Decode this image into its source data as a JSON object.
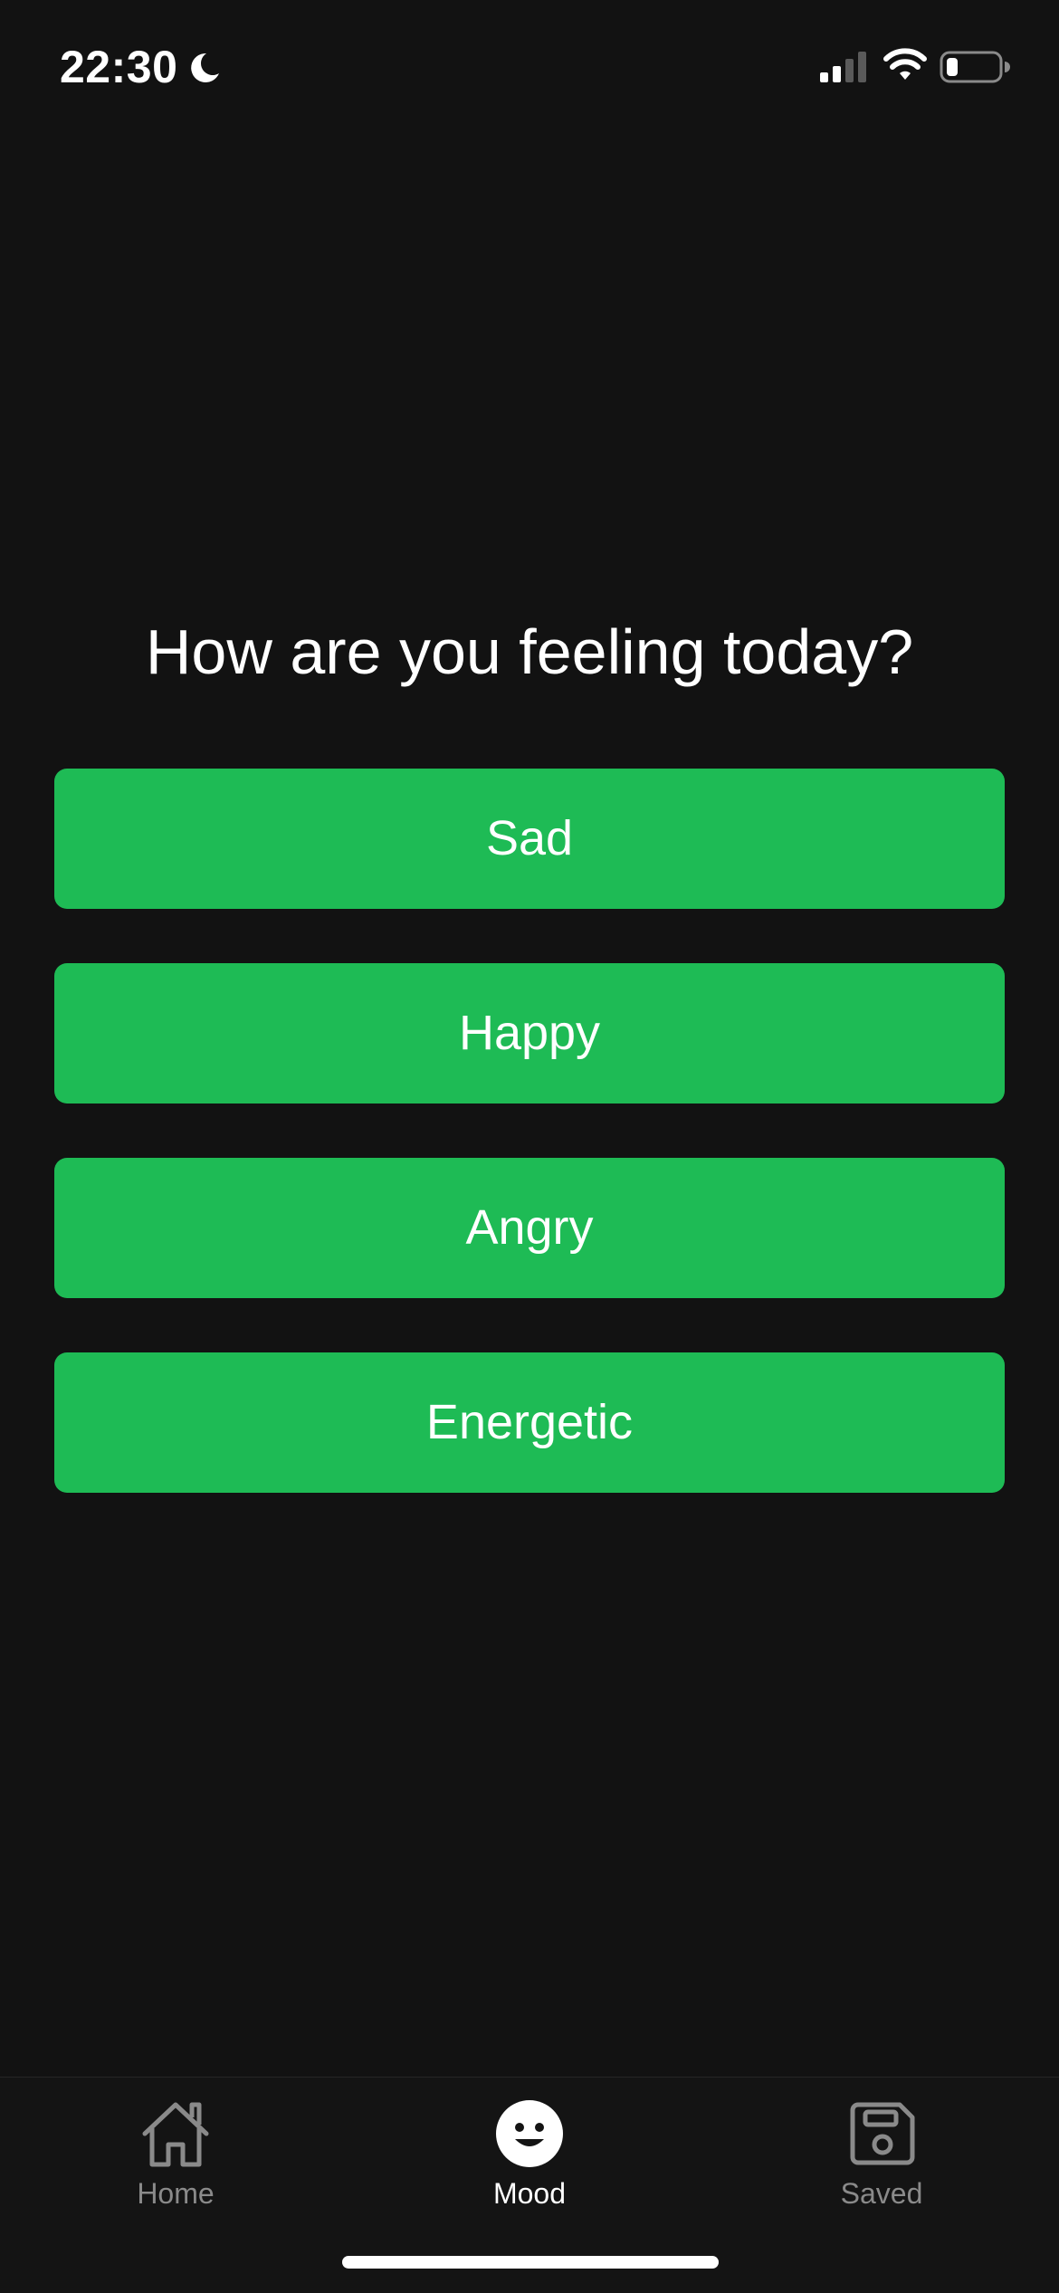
{
  "status_bar": {
    "time": "22:30",
    "icons": [
      "moon-icon",
      "cellular-signal-icon",
      "wifi-icon",
      "battery-icon"
    ]
  },
  "main": {
    "question": "How are you feeling today?",
    "moods": [
      {
        "label": "Sad"
      },
      {
        "label": "Happy"
      },
      {
        "label": "Angry"
      },
      {
        "label": "Energetic"
      }
    ]
  },
  "tab_bar": {
    "active": "Mood",
    "tabs": [
      {
        "label": "Home",
        "icon": "house-icon"
      },
      {
        "label": "Mood",
        "icon": "smiley-face-icon"
      },
      {
        "label": "Saved",
        "icon": "floppy-disk-icon"
      }
    ]
  },
  "colors": {
    "background": "#121212",
    "accent": "#1ebb55",
    "text": "#ffffff",
    "inactive_tab": "#8a8a8a"
  }
}
